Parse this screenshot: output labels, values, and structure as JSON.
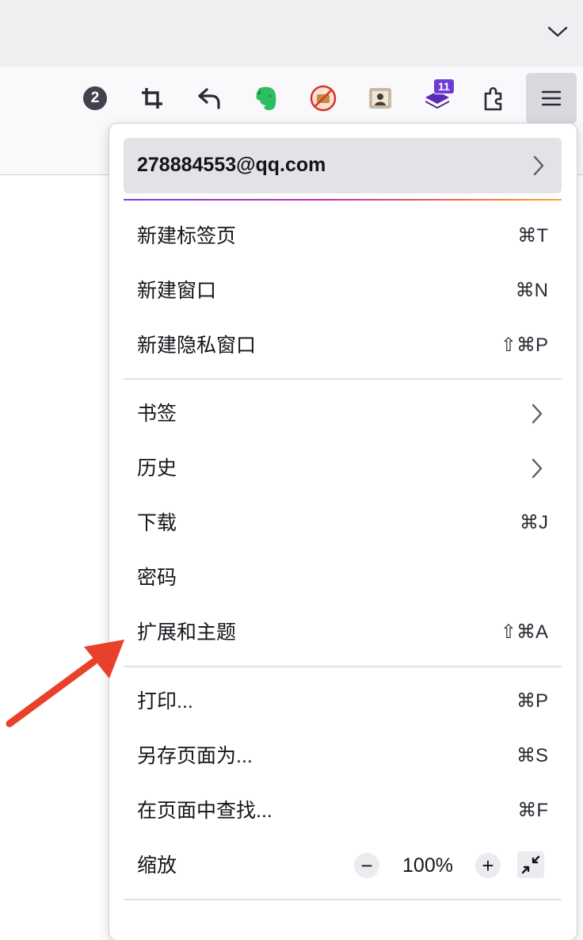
{
  "toolbar": {
    "badge_count": "2",
    "extension_badge": "11",
    "icons": [
      "counter-badge-icon",
      "crop-icon",
      "undo-icon",
      "evernote-icon",
      "blocker-extension-icon",
      "photo-extension-icon",
      "stack-extension-icon",
      "extensions-puzzle-icon",
      "hamburger-menu-icon"
    ]
  },
  "menu": {
    "account": "278884553@qq.com",
    "items": [
      {
        "label": "新建标签页",
        "shortcut": "⌘T"
      },
      {
        "label": "新建窗口",
        "shortcut": "⌘N"
      },
      {
        "label": "新建隐私窗口",
        "shortcut": "⇧⌘P"
      },
      {
        "label": "书签",
        "shortcut": ""
      },
      {
        "label": "历史",
        "shortcut": ""
      },
      {
        "label": "下载",
        "shortcut": "⌘J"
      },
      {
        "label": "密码",
        "shortcut": ""
      },
      {
        "label": "扩展和主题",
        "shortcut": "⇧⌘A"
      },
      {
        "label": "打印...",
        "shortcut": "⌘P"
      },
      {
        "label": "另存页面为...",
        "shortcut": "⌘S"
      },
      {
        "label": "在页面中查找...",
        "shortcut": "⌘F"
      },
      {
        "label": "缩放",
        "shortcut": ""
      }
    ],
    "zoom": {
      "minus": "−",
      "value": "100%",
      "plus": "+"
    }
  },
  "colors": {
    "accent_start": "#7542e5",
    "accent_end": "#ffa436",
    "annotation_arrow": "#e8402a"
  }
}
